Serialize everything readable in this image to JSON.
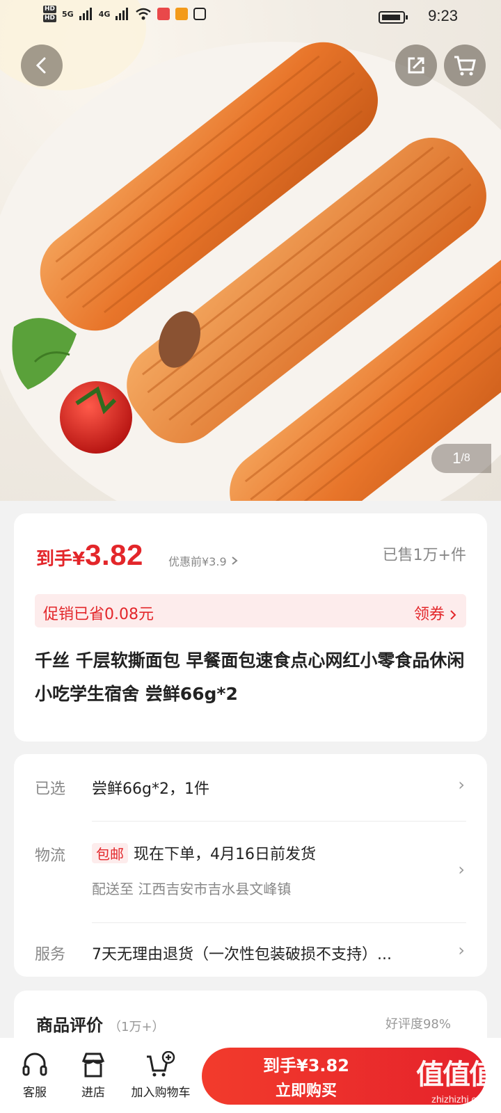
{
  "status_bar": {
    "time": "9:23",
    "signal_1": "5G",
    "signal_2": "4G"
  },
  "header": {
    "back_icon": "chevron-left-icon",
    "share_icon": "share-icon",
    "cart_icon": "cart-icon"
  },
  "gallery": {
    "current": "1",
    "total": "/8"
  },
  "price": {
    "prefix": "到手¥",
    "value": "3.82",
    "before_label": "优惠前¥3.9",
    "sold": "已售1万+件"
  },
  "promo": {
    "text": "促销已省0.08元",
    "coupon": "领券"
  },
  "product": {
    "title": "千丝 千层软撕面包 早餐面包速食点心网红小零食品休闲小吃学生宿舍 尝鲜66g*2"
  },
  "info": {
    "selected_label": "已选",
    "selected_value": "尝鲜66g*2，1件",
    "logistics_label": "物流",
    "logistics_badge": "包邮",
    "logistics_value": "现在下单，4月16日前发货",
    "delivery_value": "配送至  江西吉安市吉水县文峰镇",
    "service_label": "服务",
    "service_value": "7天无理由退货（一次性包装破损不支持）..."
  },
  "review": {
    "title": "商品评价",
    "count": "（1万+）",
    "rate": "好评度98%"
  },
  "bottom_bar": {
    "service": "客服",
    "store": "进店",
    "add_cart": "加入购物车",
    "buy_price": "到手¥3.82",
    "buy_label": "立即购买"
  },
  "watermark": {
    "text": "值值值",
    "url": "zhizhizhi.com"
  },
  "colors": {
    "accent": "#e3262a",
    "promo_bg": "#fdecec"
  }
}
